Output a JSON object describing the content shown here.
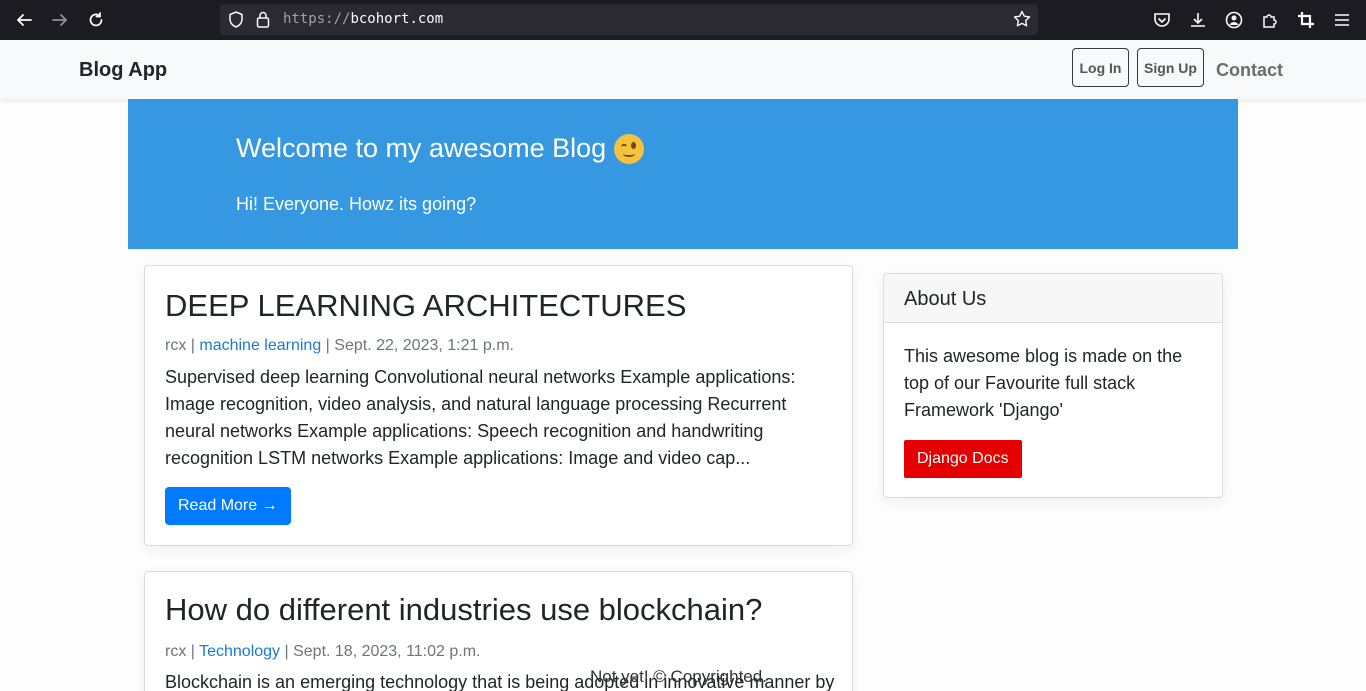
{
  "browser": {
    "url_scheme": "https://",
    "url_host": "bcohort.com"
  },
  "navbar": {
    "brand": "Blog App",
    "login_label": "Log In",
    "signup_label": "Sign Up",
    "contact_label": "Contact"
  },
  "hero": {
    "title": "Welcome to my awesome Blog",
    "subtitle": "Hi! Everyone. Howz its going?"
  },
  "posts": [
    {
      "title": "DEEP LEARNING ARCHITECTURES",
      "author": "rcx",
      "category": "machine learning",
      "date": "Sept. 22, 2023, 1:21 p.m.",
      "excerpt": "Supervised deep learning Convolutional neural networks Example applications: Image recognition, video analysis, and natural language processing Recurrent neural networks Example applications: Speech recognition and handwriting recognition LSTM networks Example applications: Image and video cap...",
      "button": "Read More →"
    },
    {
      "title": "How do different industries use blockchain?",
      "author": "rcx",
      "category": "Technology",
      "date": "Sept. 18, 2023, 11:02 p.m.",
      "excerpt": "Blockchain is an emerging technology that is being adopted in innovative manner by"
    }
  ],
  "sidebar": {
    "title": "About Us",
    "text": "This awesome blog is made on the top of our Favourite full stack Framework 'Django'",
    "button": "Django Docs"
  },
  "footer": {
    "text": "Not yet! © Copyrighted."
  },
  "colors": {
    "hero_bg": "#3598e0",
    "primary": "#007bff",
    "danger": "#e50000",
    "link": "#1a7ad6"
  }
}
